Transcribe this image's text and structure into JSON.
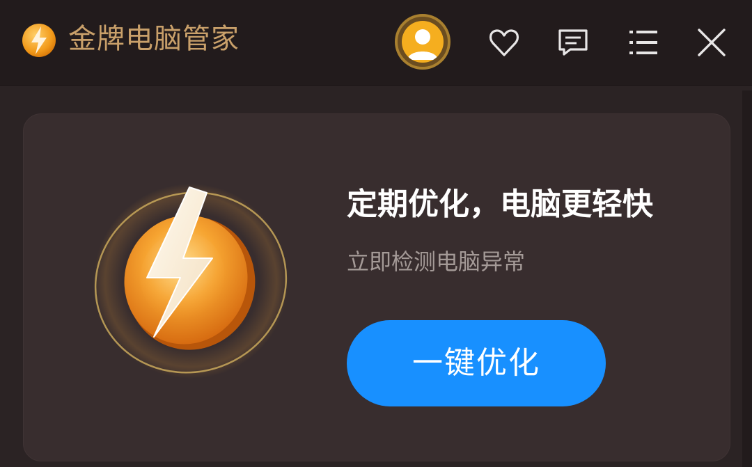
{
  "app": {
    "title": "金牌电脑管家",
    "logo_icon": "lightning-bolt-icon"
  },
  "toolbar": {
    "avatar_icon": "user-avatar-icon",
    "icons": [
      "heart-icon",
      "message-icon",
      "menu-icon",
      "close-icon"
    ]
  },
  "card": {
    "title": "定期优化，电脑更轻快",
    "subtitle": "立即检测电脑异常",
    "button_label": "一键优化",
    "hero_icon": "lightning-coin-icon"
  },
  "colors": {
    "titlebar_bg": "#221b1c",
    "window_bg": "#2b2324",
    "card_bg": "#382d2e",
    "title_gold": "#c9a06a",
    "button_blue": "#1890ff",
    "subtitle_gray": "#a49a97"
  }
}
